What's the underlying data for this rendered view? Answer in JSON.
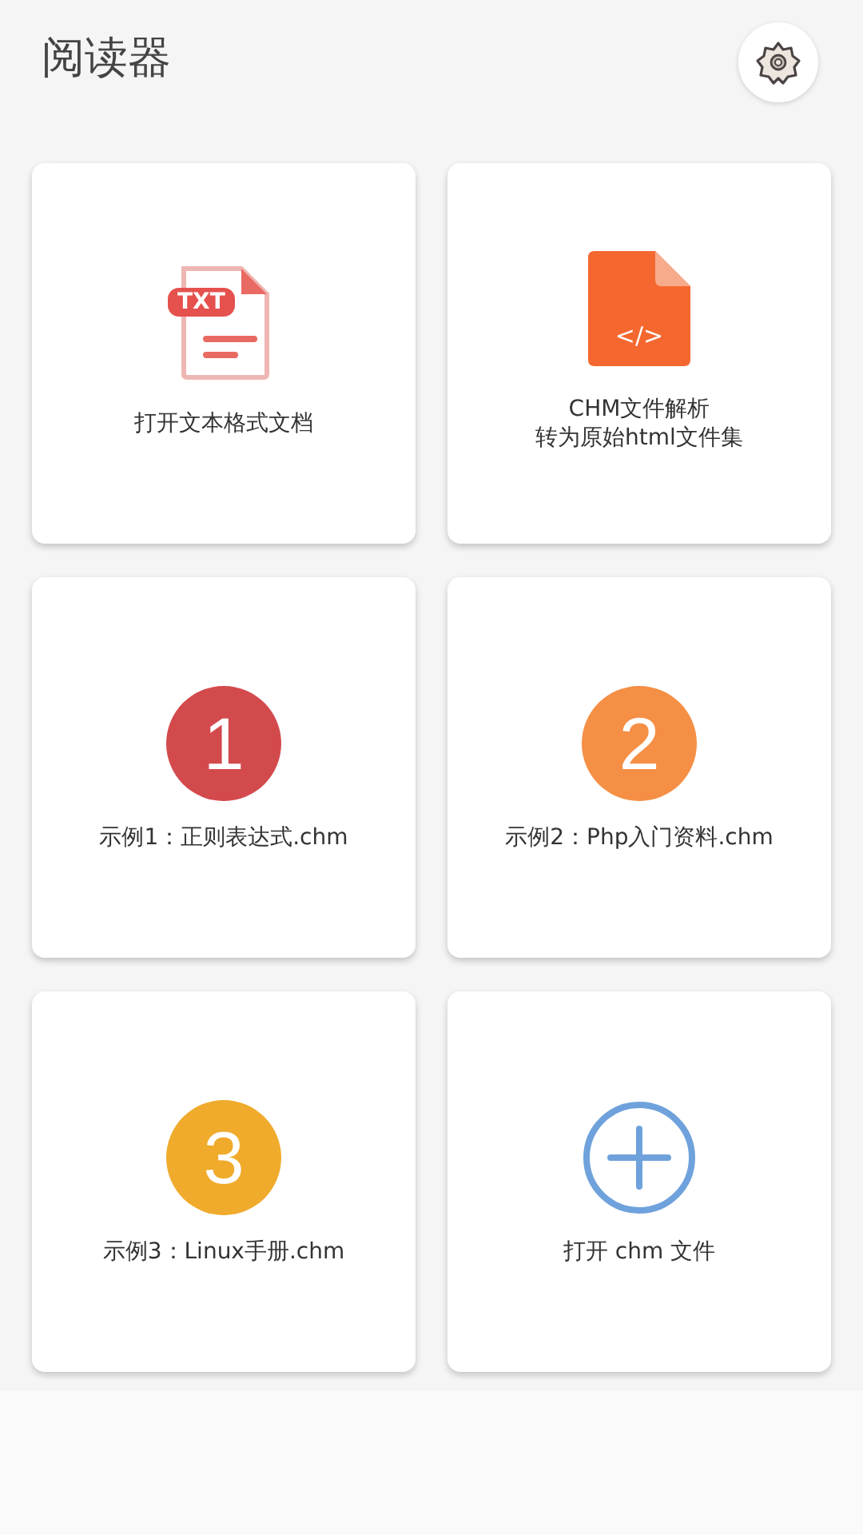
{
  "header": {
    "title": "阅读器"
  },
  "cards": [
    {
      "kind": "txt",
      "icon_text": "TXT",
      "lines": [
        "打开文本格式文档"
      ]
    },
    {
      "kind": "code",
      "icon_text": "</>",
      "lines": [
        "CHM文件解析",
        "转为原始html文件集"
      ]
    },
    {
      "kind": "number",
      "icon_text": "1",
      "color": "#d34a4d",
      "lines": [
        "示例1：正则表达式.chm"
      ]
    },
    {
      "kind": "number",
      "icon_text": "2",
      "color": "#f58f45",
      "lines": [
        "示例2：Php入门资料.chm"
      ]
    },
    {
      "kind": "number",
      "icon_text": "3",
      "color": "#f0ab2c",
      "lines": [
        "示例3：Linux手册.chm"
      ]
    },
    {
      "kind": "add",
      "lines": [
        "打开 chm 文件"
      ]
    }
  ]
}
